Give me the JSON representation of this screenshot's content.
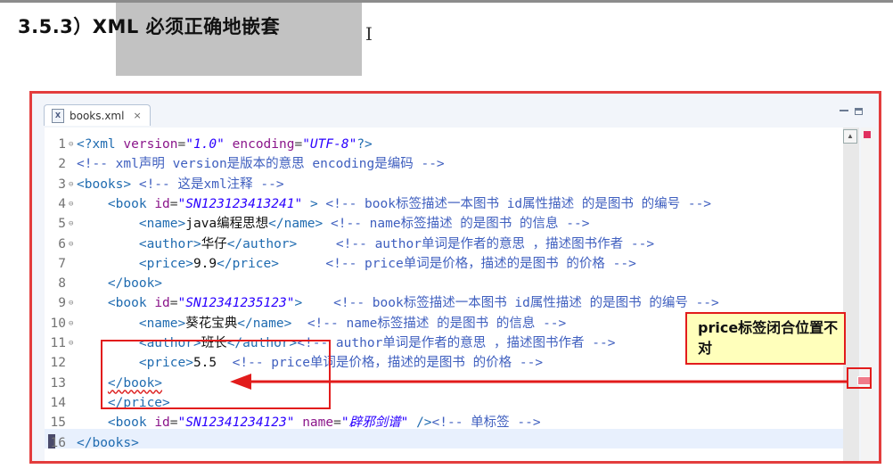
{
  "slide": {
    "title": "3.5.3）XML  必须正确地嵌套",
    "cursor_glyph": "I"
  },
  "editor": {
    "tab": {
      "icon_letter": "X",
      "label": "books.xml",
      "close": "×"
    },
    "lines": [
      {
        "n": "1",
        "fold": "⊖",
        "segs": [
          [
            "tag",
            "<?xml "
          ],
          [
            "attr",
            "version"
          ],
          [
            "code",
            "="
          ],
          [
            "val",
            "\"1.0\""
          ],
          [
            "code",
            " "
          ],
          [
            "attr",
            "encoding"
          ],
          [
            "code",
            "="
          ],
          [
            "val",
            "\"UTF-8\""
          ],
          [
            "tag",
            "?>"
          ]
        ]
      },
      {
        "n": "2",
        "fold": "",
        "segs": [
          [
            "cmt",
            "<!-- xml声明 version是版本的意思 encoding是编码 -->"
          ]
        ]
      },
      {
        "n": "3",
        "fold": "⊖",
        "segs": [
          [
            "tag",
            "<books>"
          ],
          [
            "code",
            " "
          ],
          [
            "cmt",
            "<!-- 这是xml注释 -->"
          ]
        ]
      },
      {
        "n": "4",
        "fold": "⊖",
        "segs": [
          [
            "code",
            "    "
          ],
          [
            "tag",
            "<book "
          ],
          [
            "attr",
            "id"
          ],
          [
            "code",
            "="
          ],
          [
            "val",
            "\"SN123123413241\""
          ],
          [
            "code",
            " "
          ],
          [
            "tag",
            ">"
          ],
          [
            "code",
            " "
          ],
          [
            "cmt",
            "<!-- book标签描述一本图书 id属性描述 的是图书 的编号 -->"
          ]
        ]
      },
      {
        "n": "5",
        "fold": "⊖",
        "segs": [
          [
            "code",
            "        "
          ],
          [
            "tag",
            "<name>"
          ],
          [
            "txt",
            "java编程思想"
          ],
          [
            "tag",
            "</name>"
          ],
          [
            "code",
            " "
          ],
          [
            "cmt",
            "<!-- name标签描述 的是图书 的信息 -->"
          ]
        ]
      },
      {
        "n": "6",
        "fold": "⊖",
        "segs": [
          [
            "code",
            "        "
          ],
          [
            "tag",
            "<author>"
          ],
          [
            "txt",
            "华仔"
          ],
          [
            "tag",
            "</author>"
          ],
          [
            "code",
            "     "
          ],
          [
            "cmt",
            "<!-- author单词是作者的意思 ，描述图书作者 -->"
          ]
        ]
      },
      {
        "n": "7",
        "fold": "",
        "segs": [
          [
            "code",
            "        "
          ],
          [
            "tag",
            "<price>"
          ],
          [
            "txt",
            "9.9"
          ],
          [
            "tag",
            "</price>"
          ],
          [
            "code",
            "      "
          ],
          [
            "cmt",
            "<!-- price单词是价格，描述的是图书 的价格 -->"
          ]
        ]
      },
      {
        "n": "8",
        "fold": "",
        "segs": [
          [
            "code",
            "    "
          ],
          [
            "tag",
            "</book>"
          ]
        ]
      },
      {
        "n": "9",
        "fold": "⊖",
        "segs": [
          [
            "code",
            "    "
          ],
          [
            "tag",
            "<book "
          ],
          [
            "attr",
            "id"
          ],
          [
            "code",
            "="
          ],
          [
            "val",
            "\"SN12341235123\""
          ],
          [
            "tag",
            ">"
          ],
          [
            "code",
            "    "
          ],
          [
            "cmt",
            "<!-- book标签描述一本图书 id属性描述 的是图书 的编号 -->"
          ]
        ]
      },
      {
        "n": "10",
        "fold": "⊖",
        "segs": [
          [
            "code",
            "        "
          ],
          [
            "tag",
            "<name>"
          ],
          [
            "txt",
            "葵花宝典"
          ],
          [
            "tag",
            "</name>"
          ],
          [
            "code",
            "  "
          ],
          [
            "cmt",
            "<!-- name标签描述 的是图书 的信息 -->"
          ]
        ]
      },
      {
        "n": "11",
        "fold": "⊖",
        "segs": [
          [
            "code",
            "        "
          ],
          [
            "tag",
            "<author>"
          ],
          [
            "txt",
            "班长"
          ],
          [
            "tag",
            "</author>"
          ],
          [
            "cmt",
            "<!-- author单词是作者的意思 ，描述图书作者 -->"
          ]
        ]
      },
      {
        "n": "12",
        "fold": "",
        "segs": [
          [
            "code",
            "        "
          ],
          [
            "tag",
            "<price>"
          ],
          [
            "txt",
            "5.5"
          ],
          [
            "code",
            "  "
          ],
          [
            "cmt",
            "<!-- price单词是价格，描述的是图书 的价格 -->"
          ]
        ]
      },
      {
        "n": "13",
        "fold": "",
        "segs": [
          [
            "code",
            "    "
          ],
          [
            "tag squig",
            "</book>"
          ]
        ]
      },
      {
        "n": "14",
        "fold": "",
        "segs": [
          [
            "code",
            "    "
          ],
          [
            "tag",
            "</price>"
          ]
        ]
      },
      {
        "n": "15",
        "fold": "",
        "segs": [
          [
            "code",
            "    "
          ],
          [
            "tag",
            "<book "
          ],
          [
            "attr",
            "id"
          ],
          [
            "code",
            "="
          ],
          [
            "val",
            "\"SN12341234123\""
          ],
          [
            "code",
            " "
          ],
          [
            "attr",
            "name"
          ],
          [
            "code",
            "="
          ],
          [
            "val",
            "\"辟邪剑谱\""
          ],
          [
            "code",
            " "
          ],
          [
            "tag",
            "/>"
          ],
          [
            "cmt",
            "<!-- 单标签 -->"
          ]
        ]
      },
      {
        "n": "16",
        "fold": "",
        "segs": [
          [
            "tag",
            "</books>"
          ]
        ]
      }
    ]
  },
  "annotation": {
    "callout": "price标签闭合位置不对",
    "colors": {
      "red": "#e21c1c",
      "note_bg": "#ffffbb"
    }
  }
}
